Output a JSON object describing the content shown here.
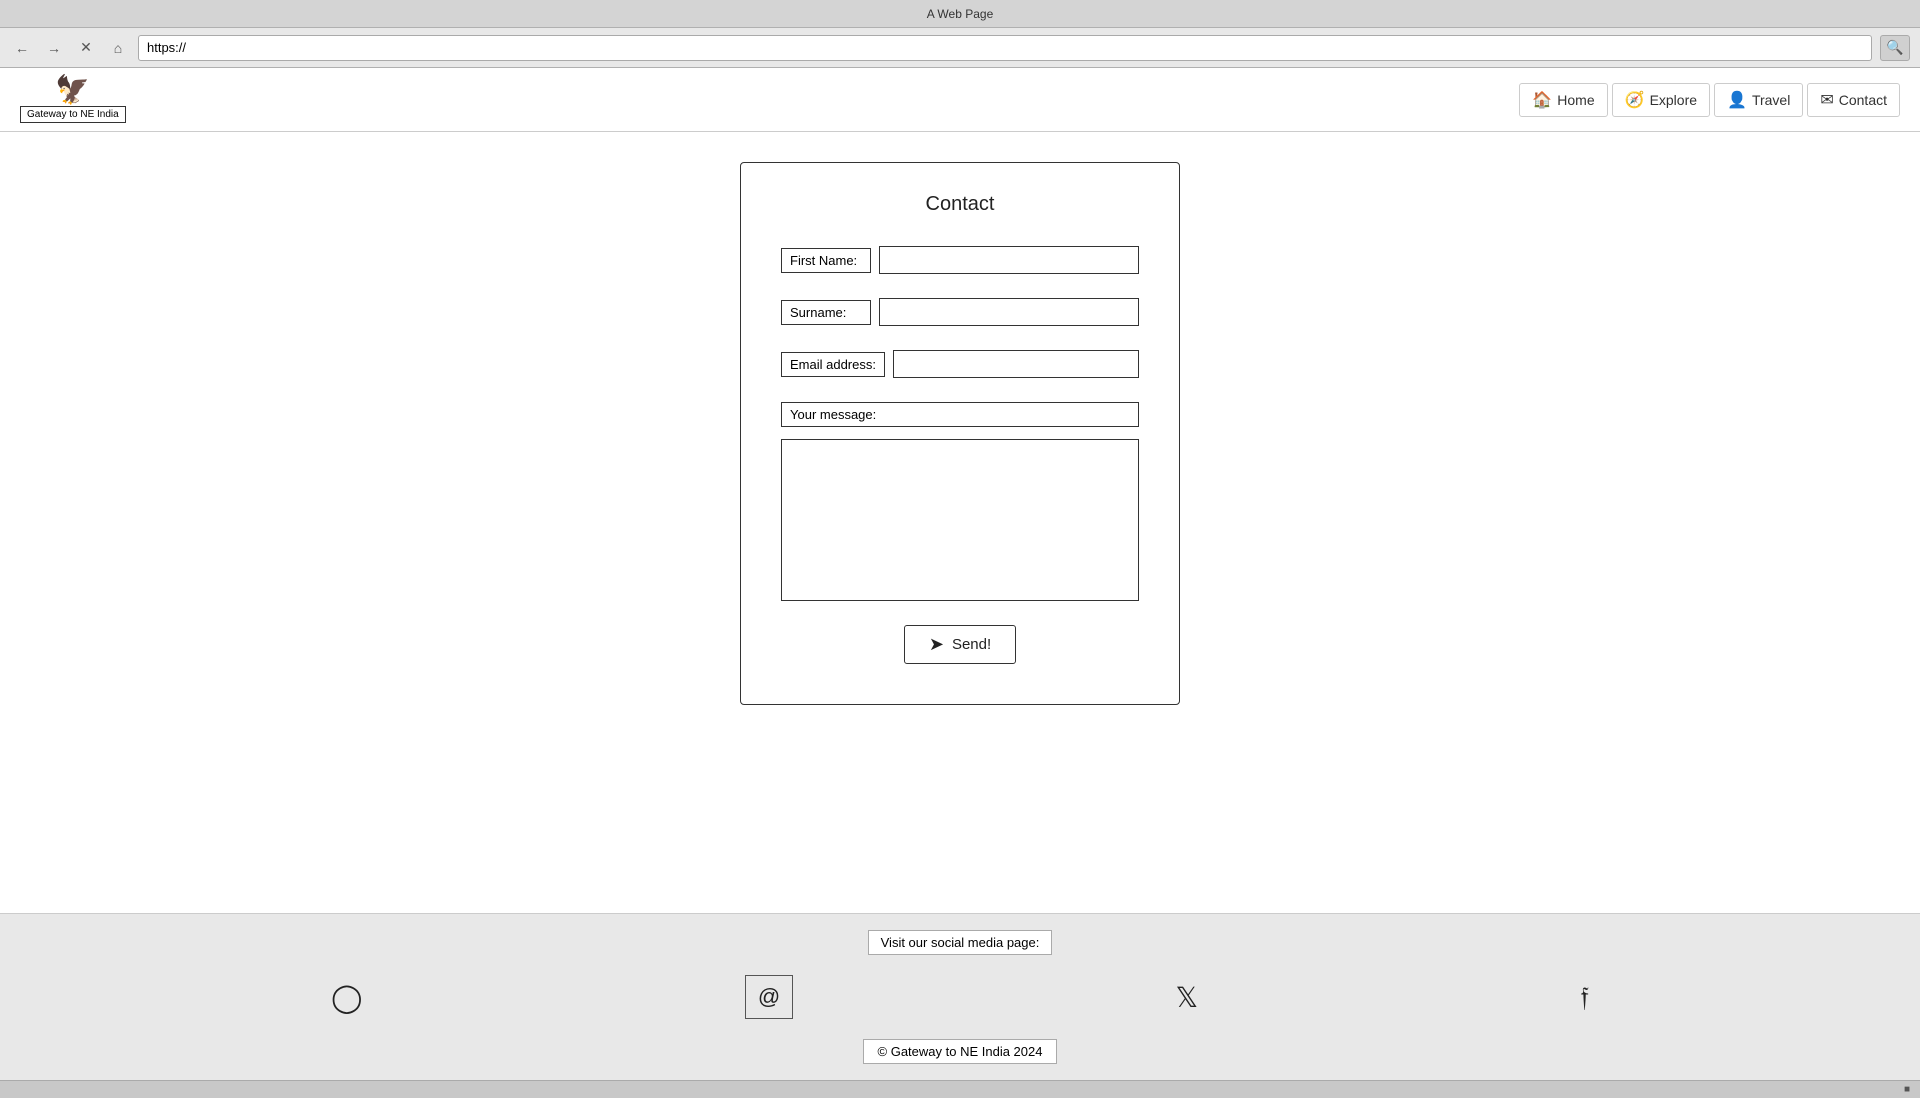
{
  "browser": {
    "title": "A Web Page",
    "url": "https://",
    "search_placeholder": ""
  },
  "nav": {
    "logo_text": "Gateway to NE India",
    "links": [
      {
        "label": "Home",
        "icon": "🏠",
        "name": "home-link"
      },
      {
        "label": "Explore",
        "icon": "🧭",
        "name": "explore-link"
      },
      {
        "label": "Travel",
        "icon": "👤",
        "name": "travel-link"
      },
      {
        "label": "Contact",
        "icon": "✉",
        "name": "contact-link"
      }
    ]
  },
  "contact_form": {
    "title": "Contact",
    "fields": {
      "first_name_label": "First Name:",
      "surname_label": "Surname:",
      "email_label": "Email address:",
      "message_label": "Your message:"
    },
    "send_button": "Send!"
  },
  "footer": {
    "social_label": "Visit our social media page:",
    "copyright": "© Gateway to NE India 2024"
  }
}
